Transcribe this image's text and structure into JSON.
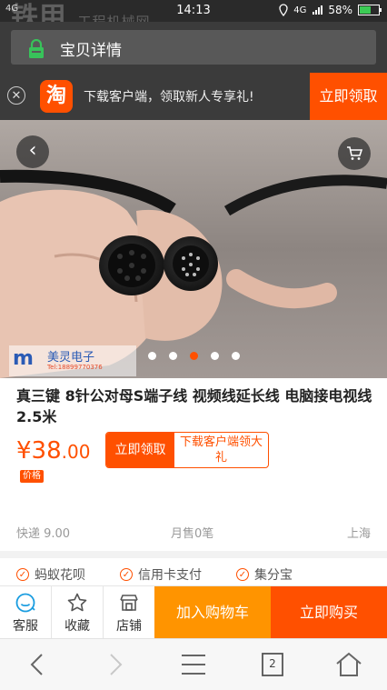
{
  "status_bar": {
    "carrier": "4G",
    "time": "14:13",
    "network": "4G",
    "battery": "58%",
    "battery_level": 0.58,
    "watermark_main": "铁甲",
    "watermark_sub": "工程机械网"
  },
  "title_bar": {
    "title": "宝贝详情"
  },
  "promo": {
    "badge": "淘",
    "text": "下载客户端，领取新人专享礼!",
    "cta": "立即领取"
  },
  "gallery": {
    "slide_count": 5,
    "active_index": 2,
    "watermark_text": "美灵电子",
    "watermark_tel": "Tel:18899770376"
  },
  "product": {
    "title": "真三键 8针公对母S端子线 视频线延长线 电脑接电视线 2.5米",
    "price_currency": "¥",
    "price_int": "38",
    "price_dec": ".00",
    "price_tag": "价格",
    "coupon_left": "立即领取",
    "coupon_right": "下载客户端领大礼",
    "shipping": "快递 9.00",
    "monthly_sales": "月售0笔",
    "location": "上海"
  },
  "services": [
    {
      "label": "蚂蚁花呗"
    },
    {
      "label": "信用卡支付"
    },
    {
      "label": "集分宝"
    }
  ],
  "action_bar": {
    "service": "客服",
    "favorite": "收藏",
    "shop": "店铺",
    "add_to_cart": "加入购物车",
    "buy_now": "立即购买"
  },
  "nav_bar": {
    "tab_count": "2"
  },
  "colors": {
    "accent": "#ff5000",
    "cart": "#ff9400",
    "dark": "#3b3b3b"
  }
}
